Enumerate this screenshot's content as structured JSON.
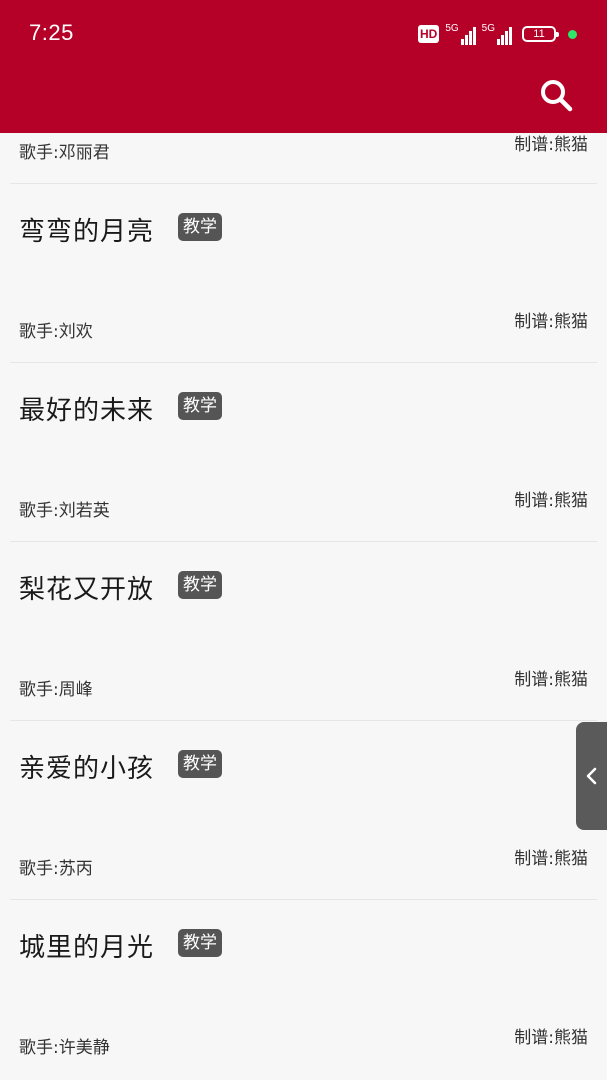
{
  "status_bar": {
    "time": "7:25",
    "hd_label": "HD",
    "signal1_label": "5G",
    "signal2_label": "5G",
    "battery_level": "11"
  },
  "toolbar": {
    "search_icon": "search-icon"
  },
  "list": {
    "partial_item": {
      "singer": "歌手:邓丽君",
      "arranger": "制谱:熊猫"
    },
    "items": [
      {
        "title": "弯弯的月亮",
        "tag": "教学",
        "singer": "歌手:刘欢",
        "arranger": "制谱:熊猫"
      },
      {
        "title": "最好的未来",
        "tag": "教学",
        "singer": "歌手:刘若英",
        "arranger": "制谱:熊猫"
      },
      {
        "title": "梨花又开放",
        "tag": "教学",
        "singer": "歌手:周峰",
        "arranger": "制谱:熊猫"
      },
      {
        "title": "亲爱的小孩",
        "tag": "教学",
        "singer": "歌手:苏丙",
        "arranger": "制谱:熊猫"
      },
      {
        "title": "城里的月光",
        "tag": "教学",
        "singer": "歌手:许美静",
        "arranger": "制谱:熊猫"
      }
    ]
  },
  "side_handle": {
    "icon": "chevron-left-icon"
  },
  "colors": {
    "header": "#b50027",
    "tag_bg": "#555555",
    "background": "#f7f7f7"
  }
}
